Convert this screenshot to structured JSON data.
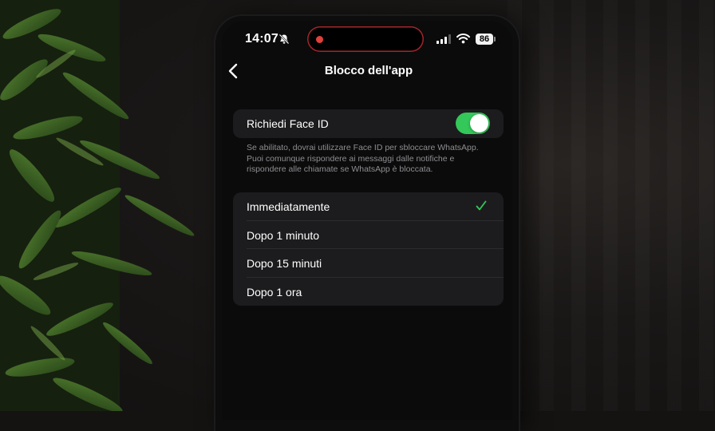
{
  "status_bar": {
    "time": "14:07",
    "battery": "86",
    "icons": [
      "bell-slash-icon",
      "cellular-signal-icon",
      "wifi-icon",
      "battery-icon"
    ],
    "recording_indicator_color": "#e0413c"
  },
  "nav": {
    "title": "Blocco dell'app",
    "back_icon": "chevron-left-icon"
  },
  "face_id": {
    "label": "Richiedi Face ID",
    "enabled": true,
    "toggle_color": "#34c759",
    "footnote": "Se abilitato, dovrai utilizzare Face ID per sbloccare WhatsApp. Puoi comunque rispondere ai messaggi dalle notifiche e rispondere alle chiamate se WhatsApp è bloccata."
  },
  "lock_timing": {
    "options": [
      {
        "label": "Immediatamente",
        "selected": true
      },
      {
        "label": "Dopo 1 minuto",
        "selected": false
      },
      {
        "label": "Dopo 15 minuti",
        "selected": false
      },
      {
        "label": "Dopo 1 ora",
        "selected": false
      }
    ],
    "check_color": "#34c759"
  }
}
